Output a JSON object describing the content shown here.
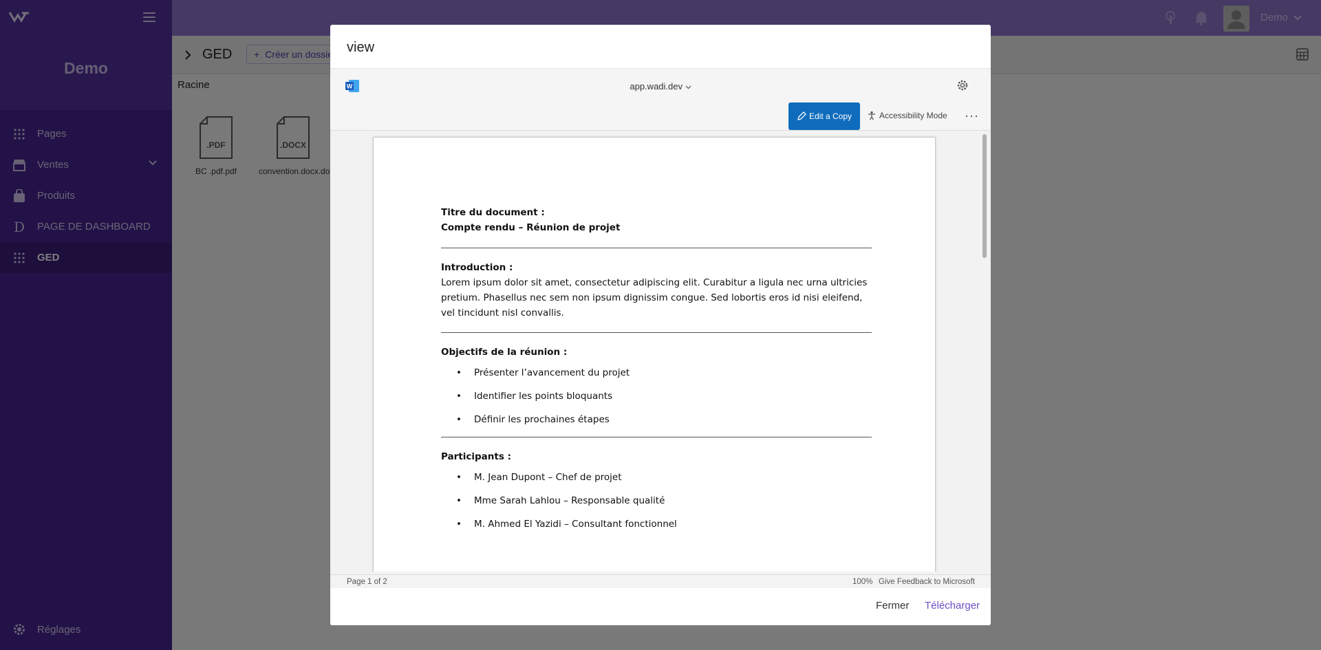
{
  "sidebar": {
    "brand": "Demo",
    "items": [
      {
        "label": "Pages"
      },
      {
        "label": "Ventes"
      },
      {
        "label": "Produits"
      },
      {
        "label": "PAGE DE DASHBOARD"
      },
      {
        "label": "GED"
      }
    ],
    "settings_label": "Réglages"
  },
  "topbar": {
    "user_name": "Demo"
  },
  "main": {
    "title": "GED",
    "create_button": "Créer un dossier",
    "breadcrumb": "Racine",
    "files": [
      {
        "name": "BC .pdf.pdf",
        "ext": ".PDF"
      },
      {
        "name": "convention.docx.docx",
        "ext": ".DOCX"
      }
    ]
  },
  "modal": {
    "title": "view",
    "viewer": {
      "domain": "app.wadi.dev",
      "edit_button": "Edit a Copy",
      "accessibility_button": "Accessibility Mode",
      "more_button": "···",
      "status": {
        "page": "Page 1 of 2",
        "zoom": "100%",
        "feedback": "Give Feedback to Microsoft"
      }
    },
    "document": {
      "title_label": "Titre du document :",
      "title_value": "Compte rendu – Réunion de projet",
      "intro_label": "Introduction :",
      "intro_text": "Lorem ipsum dolor sit amet, consectetur adipiscing elit. Curabitur a ligula nec urna ultricies pretium. Phasellus nec sem non ipsum dignissim congue. Sed lobortis eros id nisi eleifend, vel tincidunt nisl convallis.",
      "objectives_label": "Objectifs de la réunion :",
      "objectives": [
        "Présenter l’avancement du projet",
        "Identifier les points bloquants",
        "Définir les prochaines étapes"
      ],
      "participants_label": "Participants :",
      "participants": [
        "M. Jean Dupont – Chef de projet",
        "Mme Sarah Lahlou – Responsable qualité",
        "M. Ahmed El Yazidi – Consultant fonctionnel"
      ]
    },
    "footer": {
      "close_label": "Fermer",
      "download_label": "Télécharger"
    }
  }
}
